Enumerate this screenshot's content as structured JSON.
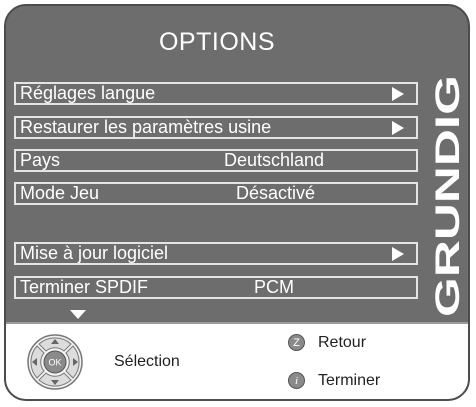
{
  "menu": {
    "title": "OPTIONS",
    "items": [
      {
        "label": "Réglages langue",
        "value": "",
        "has_arrow": true
      },
      {
        "label": "Restaurer les paramètres usine",
        "value": "",
        "has_arrow": true
      },
      {
        "label": "Pays",
        "value": "Deutschland",
        "has_arrow": false
      },
      {
        "label": "Mode Jeu",
        "value": "Désactivé",
        "has_arrow": false
      },
      {
        "label": "Mise à jour logiciel",
        "value": "",
        "has_arrow": true
      },
      {
        "label": "Terminer SPDIF",
        "value": "PCM",
        "has_arrow": false
      }
    ]
  },
  "brand": "GRUNDIG",
  "footer": {
    "nav_center": "OK",
    "selection_label": "Sélection",
    "back_key": "Z",
    "back_label": "Retour",
    "exit_key": "i",
    "exit_label": "Terminer"
  },
  "colors": {
    "panel": "#6d6d6d",
    "border": "#e4e4e4",
    "text": "#ffffff"
  },
  "icons": [
    "arrow-right-icon",
    "arrow-down-icon",
    "nav-pad-icon",
    "z-button-icon",
    "info-button-icon"
  ]
}
